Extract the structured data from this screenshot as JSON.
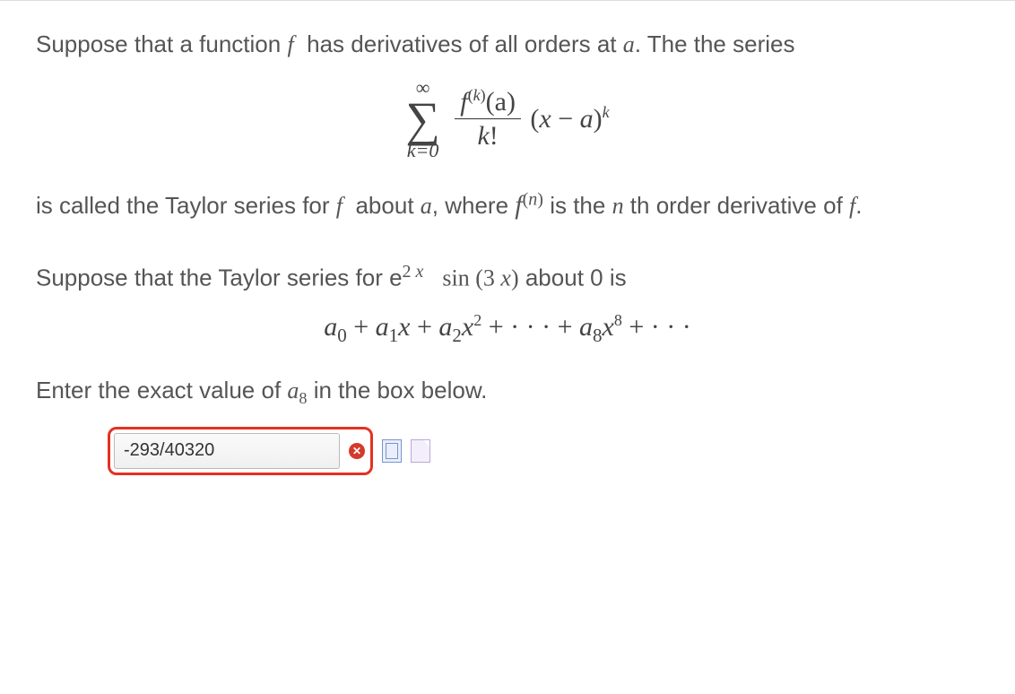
{
  "intro": {
    "line1_pre": "Suppose that a function ",
    "f": "f",
    "line1_mid": " has derivatives of all orders at ",
    "a": "a",
    "line1_post": ". The the series"
  },
  "taylor_formula": {
    "sum_top": "∞",
    "sum_bottom": "k=0",
    "num_f": "f",
    "num_sup_open": "(",
    "num_sup_k": "k",
    "num_sup_close": ")",
    "num_arg": "(a)",
    "den_k": "k",
    "den_fact": "!",
    "tail_open": "(",
    "tail_x": "x",
    "tail_minus": " − ",
    "tail_a": "a",
    "tail_close": ")",
    "tail_exp": "k"
  },
  "intro2": {
    "pre": "is called the Taylor series for ",
    "f": "f",
    "mid1": " about  ",
    "a": "a",
    "mid2": ", where ",
    "fn_f": "f",
    "fn_sup": "(n)",
    "mid3": " is the ",
    "n": "n",
    "post": " th order derivative of  ",
    "f2": "f",
    "dot": "."
  },
  "problem": {
    "pre": "Suppose that the Taylor series for e",
    "exp": "2 x",
    "sin": " sin ",
    "arg_open": "(",
    "arg_3": "3 ",
    "arg_x": "x",
    "arg_close": ")",
    "post": " about 0 is"
  },
  "series": {
    "a0": "a",
    "s0": "0",
    "plus1": " + ",
    "a1": "a",
    "s1": "1",
    "x1": "x",
    "plus2": " + ",
    "a2": "a",
    "s2": "2",
    "x2": "x",
    "e2": "2",
    "dots1": " + · · · + ",
    "a8": "a",
    "s8": "8",
    "x8": "x",
    "e8": "8",
    "dots2": " + · · ·"
  },
  "prompt": {
    "pre": "Enter the exact value of ",
    "a": "a",
    "sub": "8",
    "post": "  in the box below."
  },
  "answer": {
    "value": "-293/40320"
  }
}
